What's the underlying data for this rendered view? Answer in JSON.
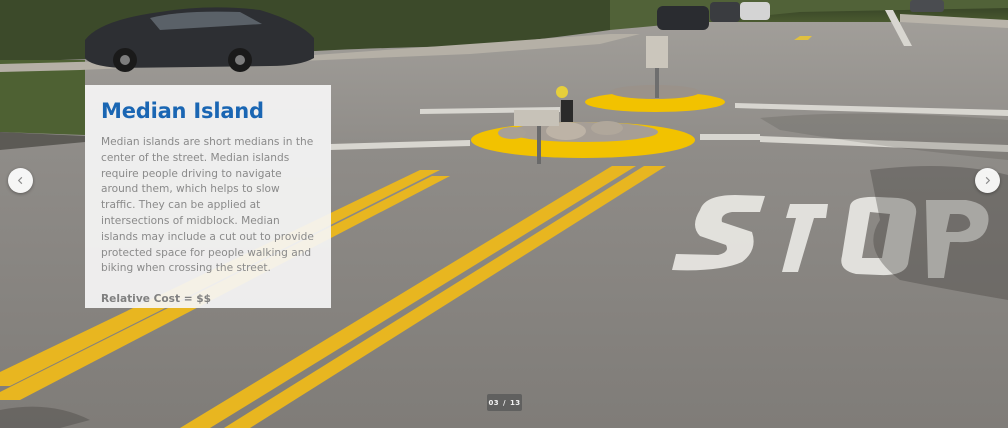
{
  "card": {
    "title": "Median Island",
    "description": "Median islands are short medians in the center of the street. Median islands require people driving to navigate around them, which helps to slow traffic. They can be applied at intersections of midblock. Median islands may include a cut out to provide protected space for people walking and biking when crossing the street.",
    "cost": "Relative Cost = $$"
  },
  "carousel": {
    "current": "03",
    "separator": "/",
    "total": "13",
    "prev_icon": "chevron-left-icon",
    "next_icon": "chevron-right-icon"
  },
  "colors": {
    "title": "#1a66b3",
    "curb_yellow": "#f2c200",
    "lane_yellow": "#e8b620",
    "asphalt": "#8e8b87"
  }
}
